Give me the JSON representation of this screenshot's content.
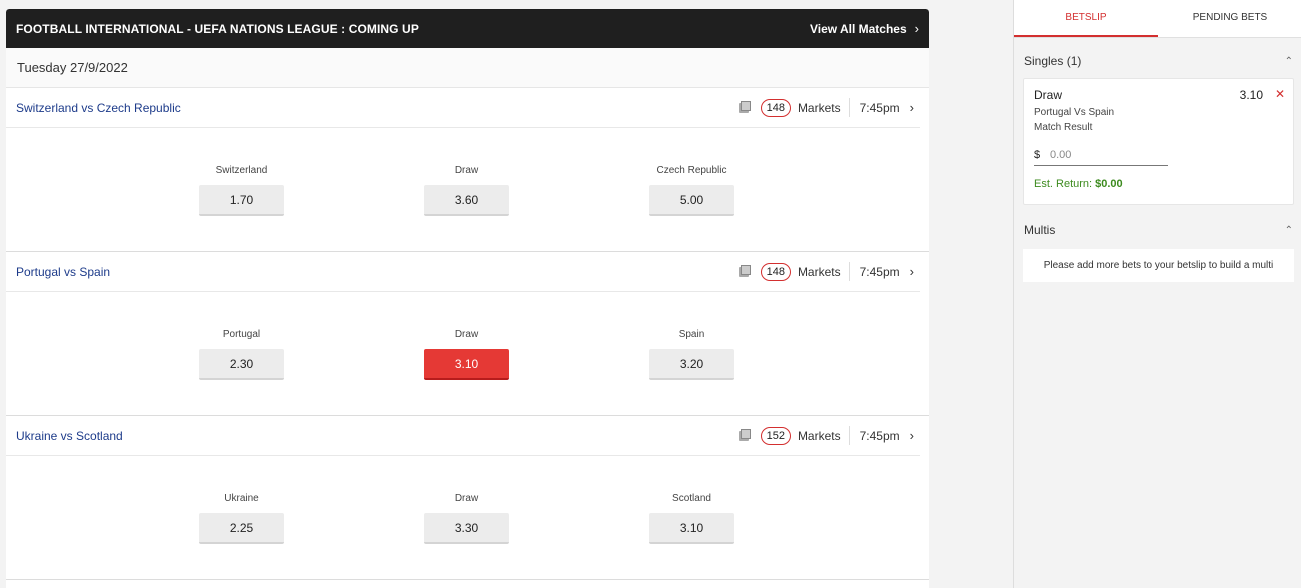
{
  "header": {
    "title": "FOOTBALL INTERNATIONAL - UEFA NATIONS LEAGUE : COMING UP",
    "view_all": "View All Matches",
    "chevron": "›"
  },
  "date": "Tuesday 27/9/2022",
  "events": [
    {
      "name": "Switzerland vs Czech Republic",
      "markets_count": "148",
      "markets_label": "Markets",
      "time": "7:45pm",
      "chevron": "›",
      "selections": [
        {
          "label": "Switzerland",
          "odds": "1.70"
        },
        {
          "label": "Draw",
          "odds": "3.60"
        },
        {
          "label": "Czech Republic",
          "odds": "5.00"
        }
      ]
    },
    {
      "name": "Portugal vs Spain",
      "markets_count": "148",
      "markets_label": "Markets",
      "time": "7:45pm",
      "chevron": "›",
      "selections": [
        {
          "label": "Portugal",
          "odds": "2.30"
        },
        {
          "label": "Draw",
          "odds": "3.10"
        },
        {
          "label": "Spain",
          "odds": "3.20"
        }
      ]
    },
    {
      "name": "Ukraine vs Scotland",
      "markets_count": "152",
      "markets_label": "Markets",
      "time": "7:45pm",
      "chevron": "›",
      "selections": [
        {
          "label": "Ukraine",
          "odds": "2.25"
        },
        {
          "label": "Draw",
          "odds": "3.30"
        },
        {
          "label": "Scotland",
          "odds": "3.10"
        }
      ]
    }
  ],
  "selected_bet": {
    "event_index": 1,
    "selection_index": 1
  },
  "betslip": {
    "tabs": [
      "BETSLIP",
      "PENDING BETS"
    ],
    "active_tab": 0,
    "singles_title": "Singles (1)",
    "caret": "⌃",
    "bet": {
      "selection": "Draw",
      "odds": "3.10",
      "remove": "✕",
      "event": "Portugal Vs Spain",
      "market": "Match Result",
      "currency": "$",
      "stake_placeholder": "0.00",
      "est_return_label": "Est. Return:",
      "est_return_value": "$0.00"
    },
    "multis_title": "Multis",
    "multis_message": "Please add more bets to your betslip to build a multi"
  },
  "colors": {
    "accent": "#d32f2f",
    "selected_button": "#e53935",
    "event_link": "#1d3b8a",
    "header_bg": "#1f1f1f",
    "return_green": "#3d8b1f"
  },
  "icons": [
    "chevron-right-icon",
    "stats-icon",
    "remove-icon",
    "caret-up-icon"
  ]
}
